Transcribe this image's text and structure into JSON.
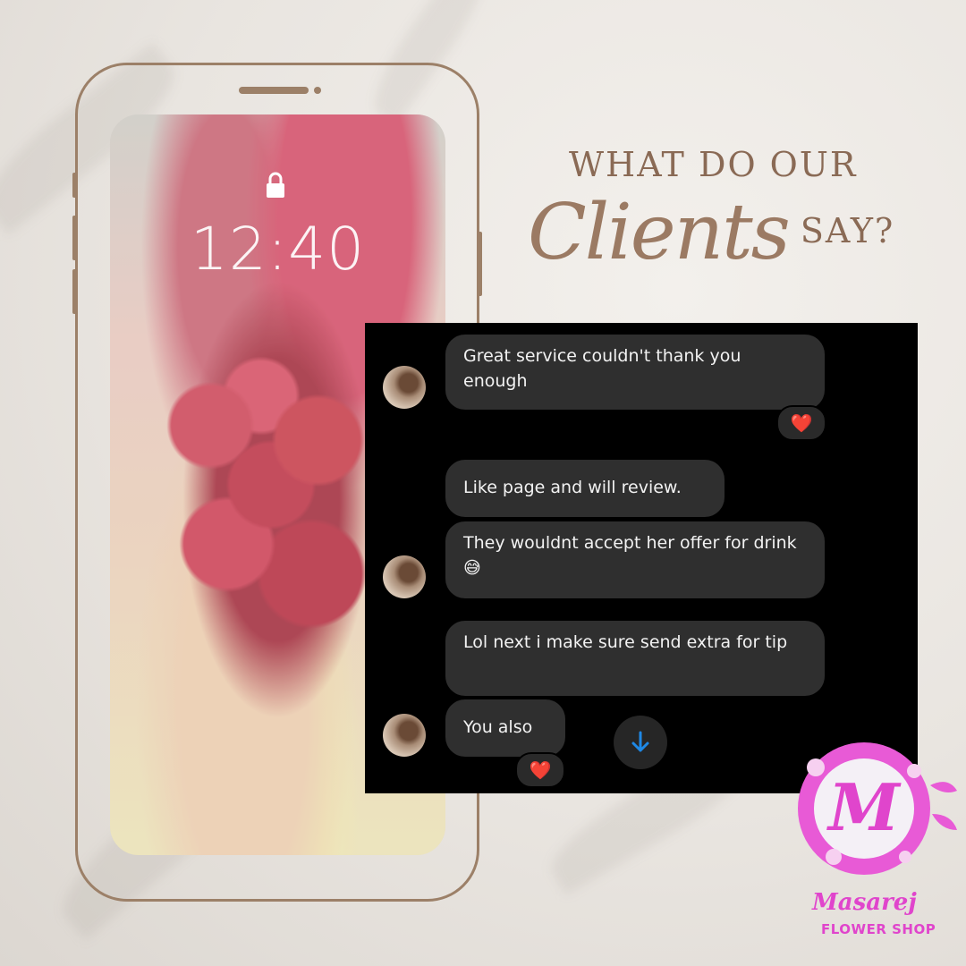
{
  "heading": {
    "line1": "WHAT DO OUR",
    "script_word": "Clients",
    "line2_end": "SAY?"
  },
  "phone": {
    "time": "12:40",
    "lock_icon": "lock-icon"
  },
  "chat": {
    "messages": [
      {
        "text": "Great service couldn't  thank you enough",
        "reaction": "❤️"
      },
      {
        "text": "Like page and will review."
      },
      {
        "text": "They wouldnt accept her offer for drink 😅"
      },
      {
        "text": "Lol next i make sure send extra for tip"
      },
      {
        "text": "You also",
        "reaction": "❤️"
      }
    ],
    "scroll_icon": "arrow-down-icon"
  },
  "colors": {
    "accent": "#9b7a63",
    "frame": "#9c8068",
    "logo": "#e045cc"
  },
  "logo": {
    "monogram": "M",
    "name": "Masarej",
    "tagline": "FLOWER SHOP"
  }
}
